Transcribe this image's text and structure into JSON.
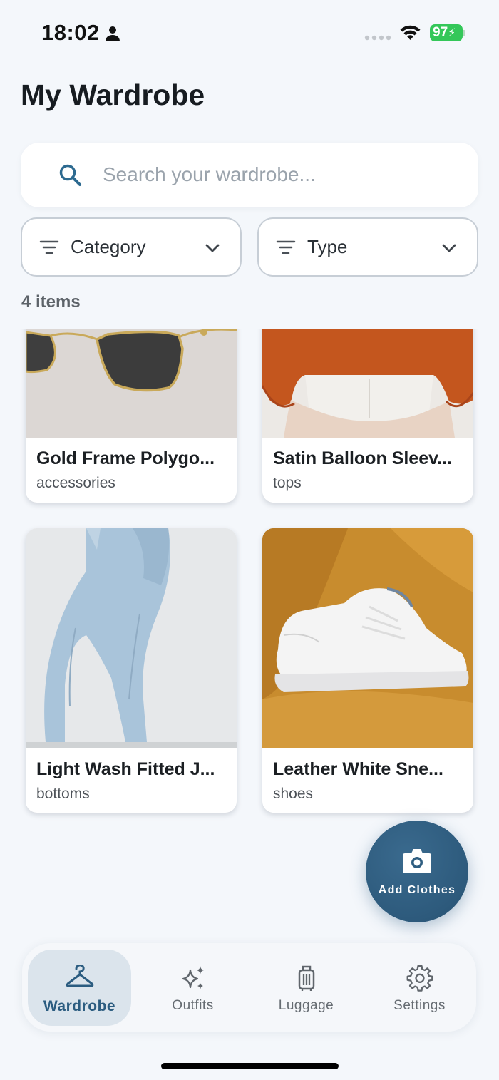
{
  "status_bar": {
    "time": "18:02",
    "battery": "97"
  },
  "header": {
    "title": "My Wardrobe"
  },
  "search": {
    "placeholder": "Search your wardrobe..."
  },
  "filters": {
    "category_label": "Category",
    "type_label": "Type"
  },
  "item_count": "4 items",
  "items": [
    {
      "title": "Gold Frame Polygo...",
      "category": "accessories"
    },
    {
      "title": "Satin Balloon Sleev...",
      "category": "tops"
    },
    {
      "title": "Light Wash Fitted J...",
      "category": "bottoms"
    },
    {
      "title": "Leather White Sne...",
      "category": "shoes"
    }
  ],
  "fab": {
    "label": "Add Clothes"
  },
  "nav": {
    "items": [
      {
        "label": "Wardrobe",
        "active": true
      },
      {
        "label": "Outfits"
      },
      {
        "label": "Luggage"
      },
      {
        "label": "Settings"
      }
    ]
  },
  "colors": {
    "accent": "#2d5a7c",
    "background": "#f4f7fb",
    "battery": "#34c759"
  }
}
